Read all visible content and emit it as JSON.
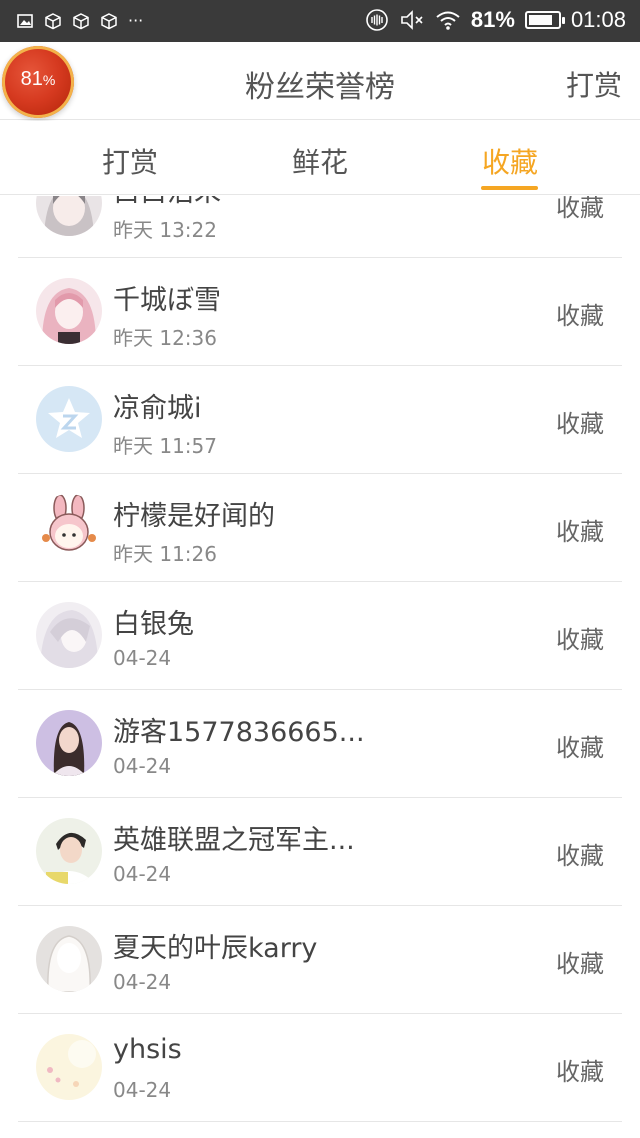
{
  "status_bar": {
    "battery_percent_text": "81%",
    "battery_level": 0.81,
    "time": "01:08",
    "left_icons": [
      "image-icon",
      "package-icon",
      "package-icon",
      "package-icon"
    ],
    "right_icons": [
      "vibrate-icon",
      "mute-icon",
      "wifi-icon"
    ]
  },
  "header": {
    "title": "粉丝荣誉榜",
    "action_label": "打赏",
    "badge_value": "81",
    "badge_unit": "%"
  },
  "tabs": [
    {
      "label": "打赏",
      "active": false
    },
    {
      "label": "鲜花",
      "active": false
    },
    {
      "label": "收藏",
      "active": true
    }
  ],
  "colors": {
    "accent": "#f5a623",
    "status_bar_bg": "#3a3a3a",
    "divider": "#e6e6e6"
  },
  "list": {
    "items": [
      {
        "name": "白白沾朱",
        "time": "昨天 13:22",
        "action": "收藏",
        "avatar": "avatar-anime-girl-icon"
      },
      {
        "name": "千城ぼ雪",
        "time": "昨天 12:36",
        "action": "收藏",
        "avatar": "avatar-pink-hair-icon"
      },
      {
        "name": "凉俞城i",
        "time": "昨天 11:57",
        "action": "收藏",
        "avatar": "avatar-qq-default-icon"
      },
      {
        "name": "柠檬是好闻的",
        "time": "昨天 11:26",
        "action": "收藏",
        "avatar": "avatar-bunny-girl-icon"
      },
      {
        "name": "白银兔",
        "time": "04-24",
        "action": "收藏",
        "avatar": "avatar-white-hair-icon"
      },
      {
        "name": "游客1577836665...",
        "time": "04-24",
        "action": "收藏",
        "avatar": "avatar-photo-girl-icon"
      },
      {
        "name": "英雄联盟之冠军主...",
        "time": "04-24",
        "action": "收藏",
        "avatar": "avatar-photo-boy-icon"
      },
      {
        "name": "夏天的叶辰karry",
        "time": "04-24",
        "action": "收藏",
        "avatar": "avatar-white-figure-icon"
      },
      {
        "name": "yhsis",
        "time": "04-24",
        "action": "收藏",
        "avatar": "avatar-pastel-icon"
      }
    ]
  }
}
